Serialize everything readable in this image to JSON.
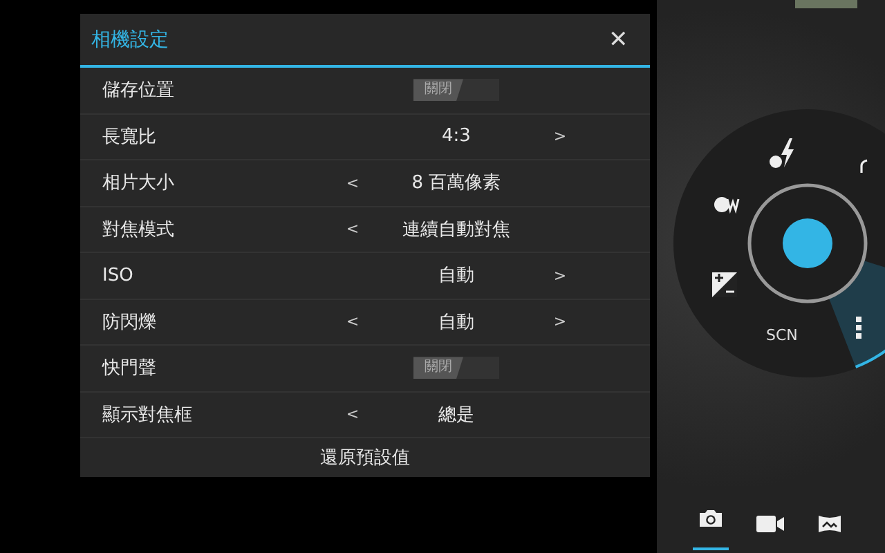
{
  "dialog": {
    "title": "相機設定",
    "close": "✕",
    "rows": [
      {
        "kind": "toggle",
        "label": "儲存位置",
        "value": "關閉",
        "on": false
      },
      {
        "kind": "choice",
        "label": "長寬比",
        "value": "4:3",
        "next": ">"
      },
      {
        "kind": "choice",
        "label": "相片大小",
        "value": "8 百萬像素",
        "prev": "<"
      },
      {
        "kind": "choice",
        "label": "對焦模式",
        "value": "連續自動對焦",
        "prev": "<"
      },
      {
        "kind": "choice",
        "label": "ISO",
        "value": "自動",
        "next": ">"
      },
      {
        "kind": "choice",
        "label": "防閃爍",
        "value": "自動",
        "prev": "<",
        "next": ">"
      },
      {
        "kind": "toggle",
        "label": "快門聲",
        "value": "關閉",
        "on": false
      },
      {
        "kind": "choice",
        "label": "顯示對焦框",
        "value": "總是",
        "prev": "<"
      }
    ],
    "reset_button": "還原預設值"
  },
  "control_wheel": {
    "scene_label": "SCN"
  },
  "modes": [
    {
      "kind": "photo",
      "selected": true
    },
    {
      "kind": "video",
      "selected": false
    },
    {
      "kind": "panorama",
      "selected": false
    }
  ]
}
